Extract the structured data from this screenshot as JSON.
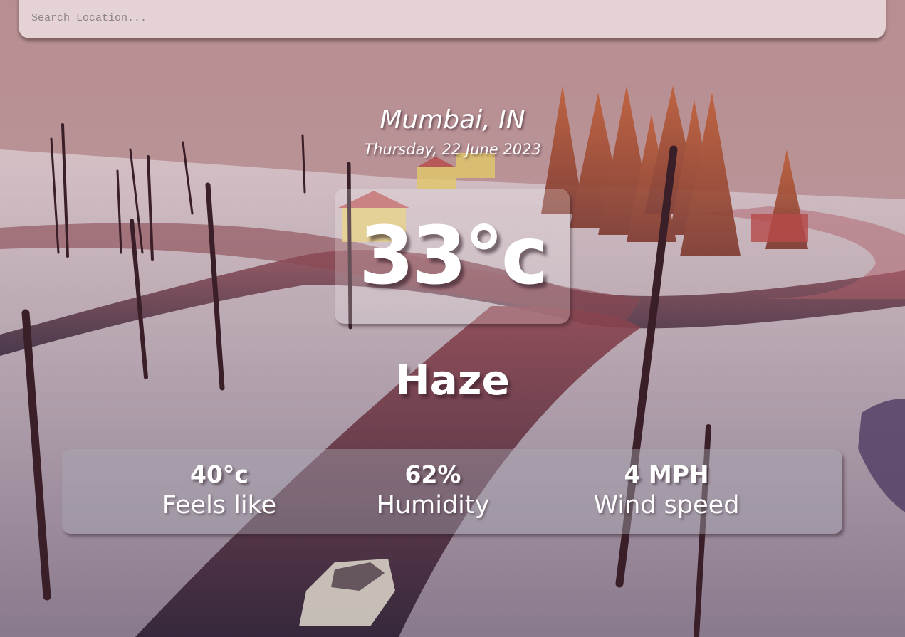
{
  "search": {
    "placeholder": "Search Location...",
    "value": ""
  },
  "location": {
    "name": "Mumbai, IN",
    "date": "Thursday, 22 June 2023"
  },
  "weather": {
    "temperature": "33°c",
    "condition": "Haze"
  },
  "stats": [
    {
      "value": "40°c",
      "label": "Feels like"
    },
    {
      "value": "62%",
      "label": "Humidity"
    },
    {
      "value": "4 MPH",
      "label": "Wind speed"
    }
  ],
  "colors": {
    "text": "#ffffff",
    "search_bg": "#ebdcde",
    "sky_top": "#b58a8f",
    "snow": "#c9b9c2",
    "road": "#7a3a45",
    "trees": "#a0452e"
  }
}
